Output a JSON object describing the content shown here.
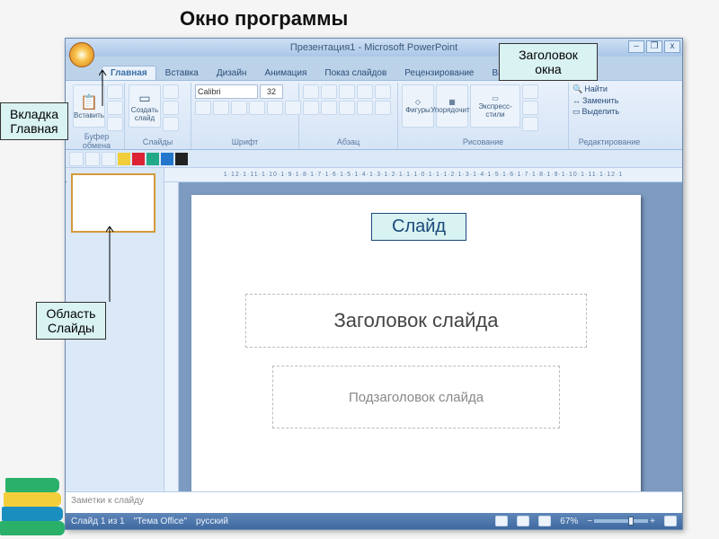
{
  "page_heading": "Окно программы",
  "callouts": {
    "home_tab": "Вкладка\nГлавная",
    "slides_area": "Область\nСлайды",
    "title_bar": "Заголовок\nокна",
    "slide": "Слайд"
  },
  "titlebar": {
    "text": "Презентация1 - Microsoft PowerPoint"
  },
  "win_controls": {
    "min": "–",
    "max": "❐",
    "close": "x"
  },
  "tabs": [
    "Главная",
    "Вставка",
    "Дизайн",
    "Анимация",
    "Показ слайдов",
    "Рецензирование",
    "Вид"
  ],
  "ribbon": {
    "groups": {
      "clipboard": {
        "paste": "Вставить",
        "label": "Буфер обмена"
      },
      "slides": {
        "new_slide": "Создать\nслайд",
        "label": "Слайды"
      },
      "font": {
        "name": "Calibri",
        "size": "32",
        "label": "Шрифт"
      },
      "paragraph": {
        "label": "Абзац"
      },
      "drawing": {
        "shapes": "Фигуры",
        "arrange": "Упорядочить",
        "styles": "Экспресс-стили",
        "label": "Рисование"
      },
      "editing": {
        "find": "Найти",
        "replace": "Заменить",
        "select": "Выделить",
        "label": "Редактирование"
      }
    }
  },
  "ruler_text": "1·12·1·11·1·10·1·9·1·8·1·7·1·6·1·5·1·4·1·3·1·2·1·1·1·0·1·1·1·2·1·3·1·4·1·5·1·6·1·7·1·8·1·9·1·10·1·11·1·12·1",
  "slide": {
    "title_placeholder": "Заголовок слайда",
    "subtitle_placeholder": "Подзаголовок слайда"
  },
  "notes_placeholder": "Заметки к слайду",
  "status": {
    "slide_info": "Слайд 1 из 1",
    "theme": "\"Тема Office\"",
    "lang": "русский",
    "zoom": "67%"
  }
}
